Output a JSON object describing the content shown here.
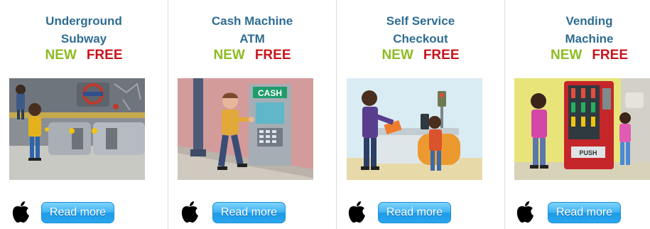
{
  "products": [
    {
      "title_line1": "Underground",
      "title_line2": "Subway",
      "tag_new": "NEW",
      "tag_free": "FREE",
      "thumbnail_icon": "subway-scene-image",
      "platform_icon": "apple-icon",
      "read_more_label": "Read more"
    },
    {
      "title_line1": "Cash Machine",
      "title_line2": "ATM",
      "tag_new": "NEW",
      "tag_free": "FREE",
      "thumbnail_icon": "atm-scene-image",
      "platform_icon": "apple-icon",
      "read_more_label": "Read more",
      "thumbnail_text": "CASH"
    },
    {
      "title_line1": "Self Service",
      "title_line2": "Checkout",
      "tag_new": "NEW",
      "tag_free": "FREE",
      "thumbnail_icon": "checkout-scene-image",
      "platform_icon": "apple-icon",
      "read_more_label": "Read more"
    },
    {
      "title_line1": "Vending",
      "title_line2": "Machine",
      "tag_new": "NEW",
      "tag_free": "FREE",
      "thumbnail_icon": "vending-scene-image",
      "platform_icon": "apple-icon",
      "read_more_label": "Read more",
      "thumbnail_text": "PUSH"
    }
  ],
  "colors": {
    "title": "#2f6d92",
    "new": "#8dbb22",
    "free": "#c8141b",
    "button": "#3fb3f3"
  }
}
